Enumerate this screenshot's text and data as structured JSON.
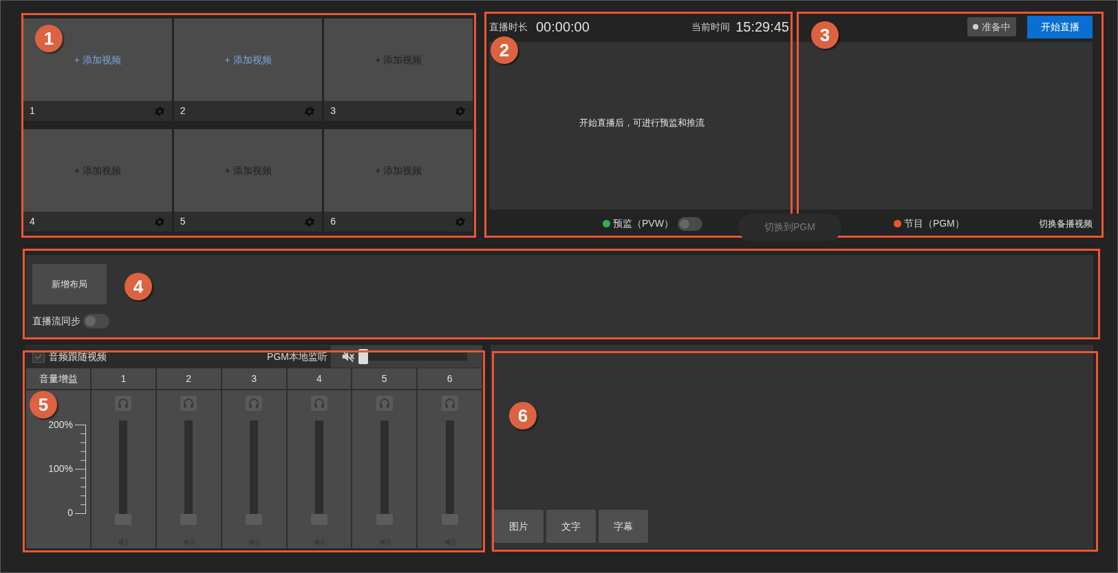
{
  "sources": [
    {
      "number": "1",
      "add_label": "+ 添加视频",
      "active": true
    },
    {
      "number": "2",
      "add_label": "+ 添加视频",
      "active": true
    },
    {
      "number": "3",
      "add_label": "+ 添加视频",
      "active": false
    },
    {
      "number": "4",
      "add_label": "+ 添加视频",
      "active": false
    },
    {
      "number": "5",
      "add_label": "+ 添加视频",
      "active": false
    },
    {
      "number": "6",
      "add_label": "+ 添加视频",
      "active": false
    }
  ],
  "preview": {
    "duration_label": "直播时长",
    "duration": "00:00:00",
    "clock_label": "当前时间",
    "clock": "15:29:45",
    "message": "开始直播后，可进行预监和推流",
    "pvw": {
      "label": "预监（PVW）",
      "color": "#33b04a",
      "toggle_on": false
    },
    "switch_button": {
      "label": "切换到PGM",
      "disabled": true
    }
  },
  "program": {
    "status": "准备中",
    "start_button": "开始直播",
    "pgm": {
      "label": "节目（PGM）",
      "color": "#f0522e"
    },
    "backup_button": "切换备播视频"
  },
  "layout": {
    "add_button": "新增布局",
    "sync_label": "直播流同步",
    "sync_on": false
  },
  "audio": {
    "follow_label": "音频跟随视频",
    "follow_checked": true,
    "monitor": {
      "label": "PGM本地监听",
      "muted": true,
      "level": 0
    },
    "gain_label": "音量增益",
    "scale": [
      "200%",
      "100%",
      "0"
    ],
    "channels": [
      {
        "name": "1",
        "level": 0
      },
      {
        "name": "2",
        "level": 0
      },
      {
        "name": "3",
        "level": 0
      },
      {
        "name": "4",
        "level": 0
      },
      {
        "name": "5",
        "level": 0
      },
      {
        "name": "6",
        "level": 0
      }
    ]
  },
  "overlays": {
    "buttons": [
      "图片",
      "文字",
      "字幕"
    ]
  },
  "annotations": [
    {
      "label": "1"
    },
    {
      "label": "2"
    },
    {
      "label": "3"
    },
    {
      "label": "4"
    },
    {
      "label": "5"
    },
    {
      "label": "6"
    }
  ]
}
